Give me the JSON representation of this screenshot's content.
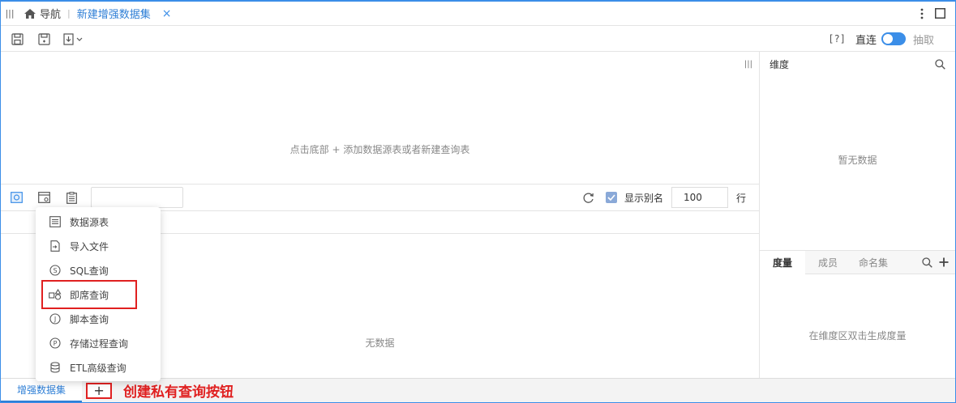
{
  "topbar": {
    "nav_label": "导航",
    "tab_label": "新建增强数据集",
    "tab_close": "×"
  },
  "toolbar": {
    "help": "[?]",
    "direct_label": "直连",
    "extract_label": "抽取"
  },
  "canvas": {
    "hint": "点击底部 + 添加数据源表或者新建查询表"
  },
  "querybar": {
    "search_value": "",
    "show_alias_label": "显示别名",
    "show_alias_checked": true,
    "rows_value": "100",
    "rows_unit": "行"
  },
  "grid": {
    "empty_text": "无数据"
  },
  "right_panel": {
    "dimension_title": "维度",
    "dimension_empty": "暂无数据",
    "tabs": [
      {
        "label": "度量",
        "active": true
      },
      {
        "label": "成员",
        "active": false
      },
      {
        "label": "命名集",
        "active": false
      }
    ],
    "measure_empty": "在维度区双击生成度量"
  },
  "dropdown": {
    "items": [
      {
        "label": "数据源表",
        "icon": "table-icon"
      },
      {
        "label": "导入文件",
        "icon": "import-file-icon"
      },
      {
        "label": "SQL查询",
        "icon": "sql-icon"
      },
      {
        "label": "即席查询",
        "icon": "adhoc-query-icon",
        "highlighted": true
      },
      {
        "label": "脚本查询",
        "icon": "script-icon"
      },
      {
        "label": "存储过程查询",
        "icon": "procedure-icon"
      },
      {
        "label": "ETL高级查询",
        "icon": "etl-icon"
      }
    ]
  },
  "bottom": {
    "tab_label": "增强数据集",
    "add_label": "+",
    "annotation": "创建私有查询按钮"
  },
  "colors": {
    "accent": "#3b8ee8",
    "annotation_red": "#e02020"
  }
}
